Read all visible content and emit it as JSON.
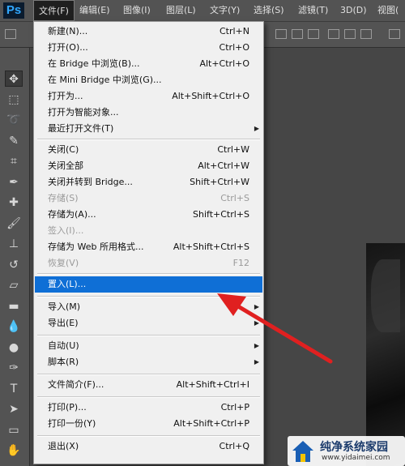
{
  "app": {
    "logo": "Ps"
  },
  "menubar": {
    "items": [
      {
        "label": "文件(F)",
        "active": true
      },
      {
        "label": "编辑(E)"
      },
      {
        "label": "图像(I)"
      },
      {
        "label": "图层(L)"
      },
      {
        "label": "文字(Y)"
      },
      {
        "label": "选择(S)"
      },
      {
        "label": "滤镜(T)"
      },
      {
        "label": "3D(D)"
      },
      {
        "label": "视图("
      }
    ]
  },
  "file_menu": {
    "items": [
      {
        "label": "新建(N)...",
        "shortcut": "Ctrl+N"
      },
      {
        "label": "打开(O)...",
        "shortcut": "Ctrl+O"
      },
      {
        "label": "在 Bridge 中浏览(B)...",
        "shortcut": "Alt+Ctrl+O"
      },
      {
        "label": "在 Mini Bridge 中浏览(G)...",
        "shortcut": ""
      },
      {
        "label": "打开为...",
        "shortcut": "Alt+Shift+Ctrl+O"
      },
      {
        "label": "打开为智能对象...",
        "shortcut": ""
      },
      {
        "label": "最近打开文件(T)",
        "shortcut": "",
        "submenu": true
      },
      {
        "label": "关闭(C)",
        "shortcut": "Ctrl+W"
      },
      {
        "label": "关闭全部",
        "shortcut": "Alt+Ctrl+W"
      },
      {
        "label": "关闭并转到 Bridge...",
        "shortcut": "Shift+Ctrl+W"
      },
      {
        "label": "存储(S)",
        "shortcut": "Ctrl+S",
        "disabled": true
      },
      {
        "label": "存储为(A)...",
        "shortcut": "Shift+Ctrl+S"
      },
      {
        "label": "签入(I)...",
        "shortcut": "",
        "disabled": true
      },
      {
        "label": "存储为 Web 所用格式...",
        "shortcut": "Alt+Shift+Ctrl+S"
      },
      {
        "label": "恢复(V)",
        "shortcut": "F12",
        "disabled": true
      },
      {
        "label": "置入(L)...",
        "shortcut": "",
        "highlighted": true
      },
      {
        "label": "导入(M)",
        "shortcut": "",
        "submenu": true
      },
      {
        "label": "导出(E)",
        "shortcut": "",
        "submenu": true
      },
      {
        "label": "自动(U)",
        "shortcut": "",
        "submenu": true
      },
      {
        "label": "脚本(R)",
        "shortcut": "",
        "submenu": true
      },
      {
        "label": "文件简介(F)...",
        "shortcut": "Alt+Shift+Ctrl+I"
      },
      {
        "label": "打印(P)...",
        "shortcut": "Ctrl+P"
      },
      {
        "label": "打印一份(Y)",
        "shortcut": "Alt+Shift+Ctrl+P"
      },
      {
        "label": "退出(X)",
        "shortcut": "Ctrl+Q"
      }
    ],
    "submenu_glyph": "▶"
  },
  "toolbar": {
    "tools": [
      {
        "icon": "move-icon",
        "glyph": "✥",
        "selected": true
      },
      {
        "icon": "marquee-icon",
        "glyph": "⬚"
      },
      {
        "icon": "lasso-icon",
        "glyph": "➰"
      },
      {
        "icon": "quick-select-icon",
        "glyph": "✎"
      },
      {
        "icon": "crop-icon",
        "glyph": "⌗"
      },
      {
        "icon": "eyedropper-icon",
        "glyph": "✒"
      },
      {
        "icon": "healing-brush-icon",
        "glyph": "✚"
      },
      {
        "icon": "brush-icon",
        "glyph": "🖌"
      },
      {
        "icon": "clone-stamp-icon",
        "glyph": "⊥"
      },
      {
        "icon": "history-brush-icon",
        "glyph": "↺"
      },
      {
        "icon": "eraser-icon",
        "glyph": "▱"
      },
      {
        "icon": "gradient-icon",
        "glyph": "▬"
      },
      {
        "icon": "blur-icon",
        "glyph": "💧"
      },
      {
        "icon": "dodge-icon",
        "glyph": "●"
      },
      {
        "icon": "pen-icon",
        "glyph": "✑"
      },
      {
        "icon": "type-icon",
        "glyph": "T"
      },
      {
        "icon": "path-select-icon",
        "glyph": "➤"
      },
      {
        "icon": "shape-icon",
        "glyph": "▭"
      },
      {
        "icon": "hand-icon",
        "glyph": "✋"
      }
    ]
  },
  "watermark": {
    "title": "纯净系统家园",
    "url": "www.yidaimei.com"
  },
  "colors": {
    "menu_highlight": "#0f6fd6",
    "annotation_arrow": "#e02020",
    "ps_brand": "#31a8ff"
  }
}
